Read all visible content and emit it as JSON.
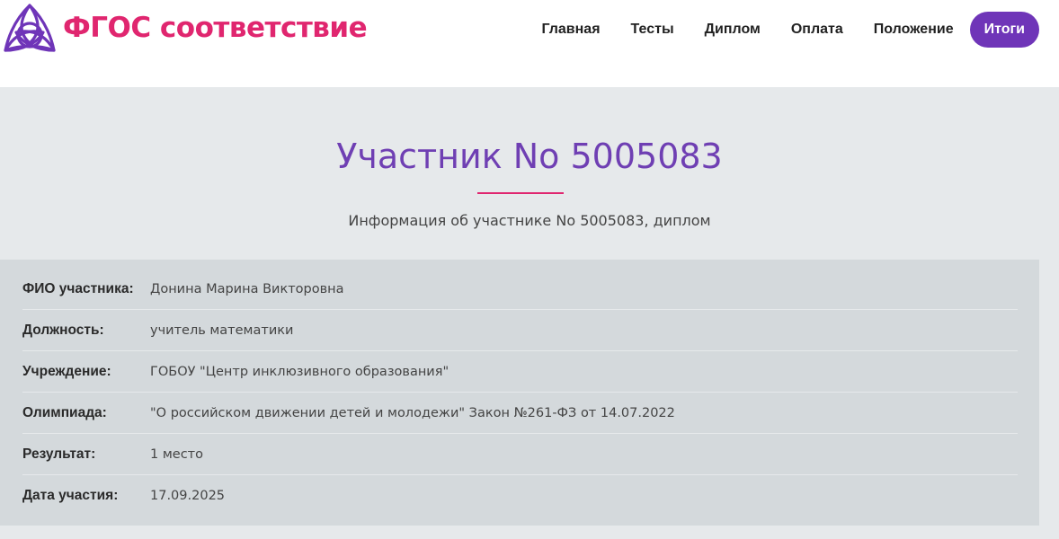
{
  "header": {
    "logo_text": "ФГОС соответствие",
    "nav": [
      {
        "label": "Главная",
        "active": false
      },
      {
        "label": "Тесты",
        "active": false
      },
      {
        "label": "Диплом",
        "active": false
      },
      {
        "label": "Оплата",
        "active": false
      },
      {
        "label": "Положение",
        "active": false
      },
      {
        "label": "Итоги",
        "active": true
      }
    ]
  },
  "main": {
    "title": "Участник No 5005083",
    "subtitle": "Информация об участнике No 5005083, диплом"
  },
  "details": [
    {
      "label": "ФИО участника:",
      "value": "Донина Марина Викторовна"
    },
    {
      "label": "Должность:",
      "value": "учитель математики"
    },
    {
      "label": "Учреждение:",
      "value": "ГОБОУ \"Центр инклюзивного образования\""
    },
    {
      "label": "Олимпиада:",
      "value": "\"О российском движении детей и молодежи\" Закон №261-ФЗ от 14.07.2022"
    },
    {
      "label": "Результат:",
      "value": "1 место"
    },
    {
      "label": "Дата участия:",
      "value": "17.09.2025"
    }
  ],
  "colors": {
    "brand_pink": "#e0266f",
    "brand_purple": "#6f35b8",
    "background": "#e6e9eb",
    "panel": "#d4d9dc"
  }
}
